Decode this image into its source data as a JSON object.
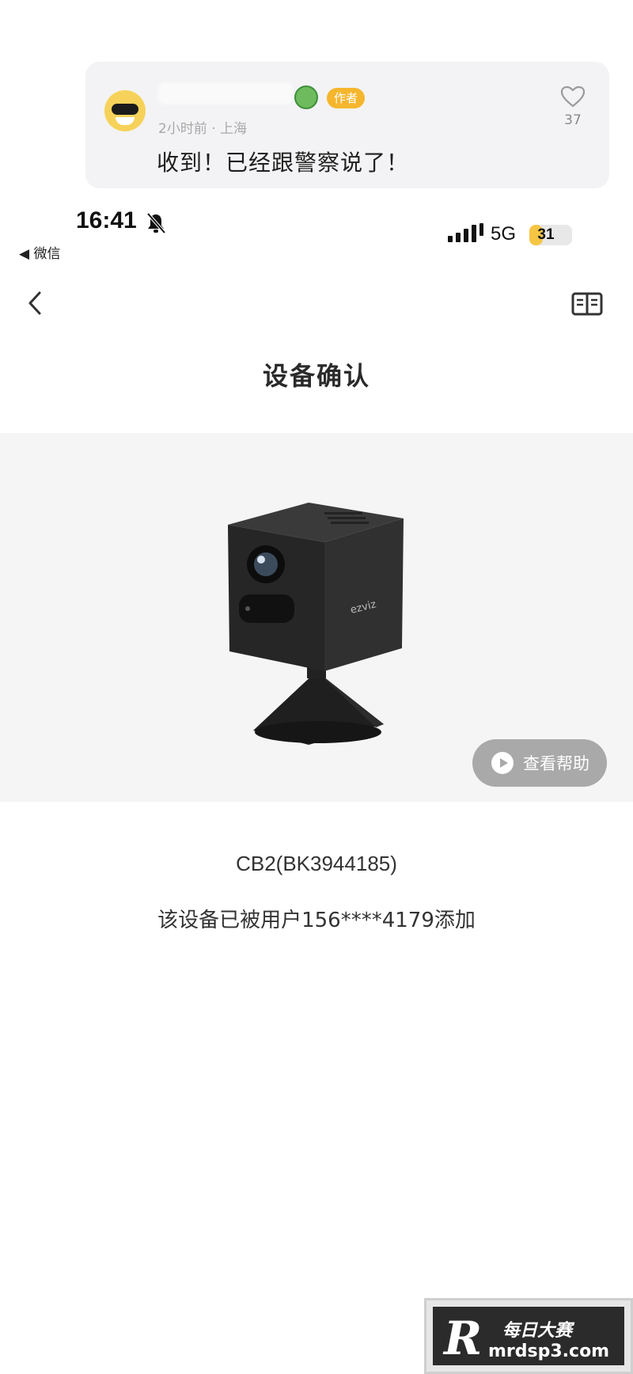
{
  "comment": {
    "meta": "2小时前 · 上海",
    "author_tag": "作者",
    "text": "收到！已经跟警察说了！",
    "likes": "37"
  },
  "status_bar": {
    "time": "16:41",
    "back_app": "◀ 微信",
    "network": "5G",
    "battery": "31",
    "battery_fraction": 0.31
  },
  "nav": {
    "title": "设备确认"
  },
  "product": {
    "help_label": "查看帮助",
    "brand_mark": "ezviz"
  },
  "device": {
    "id": "CB2(BK3944185)",
    "owner_note": "该设备已被用户156****4179添加"
  },
  "watermark": {
    "title": "每日大赛",
    "url": "mrdsp3.com"
  },
  "colors": {
    "author_tag": "#f5b62e",
    "battery_fill": "#f6c543",
    "help_button": "#a9a9a9",
    "product_bg": "#f5f5f5"
  }
}
